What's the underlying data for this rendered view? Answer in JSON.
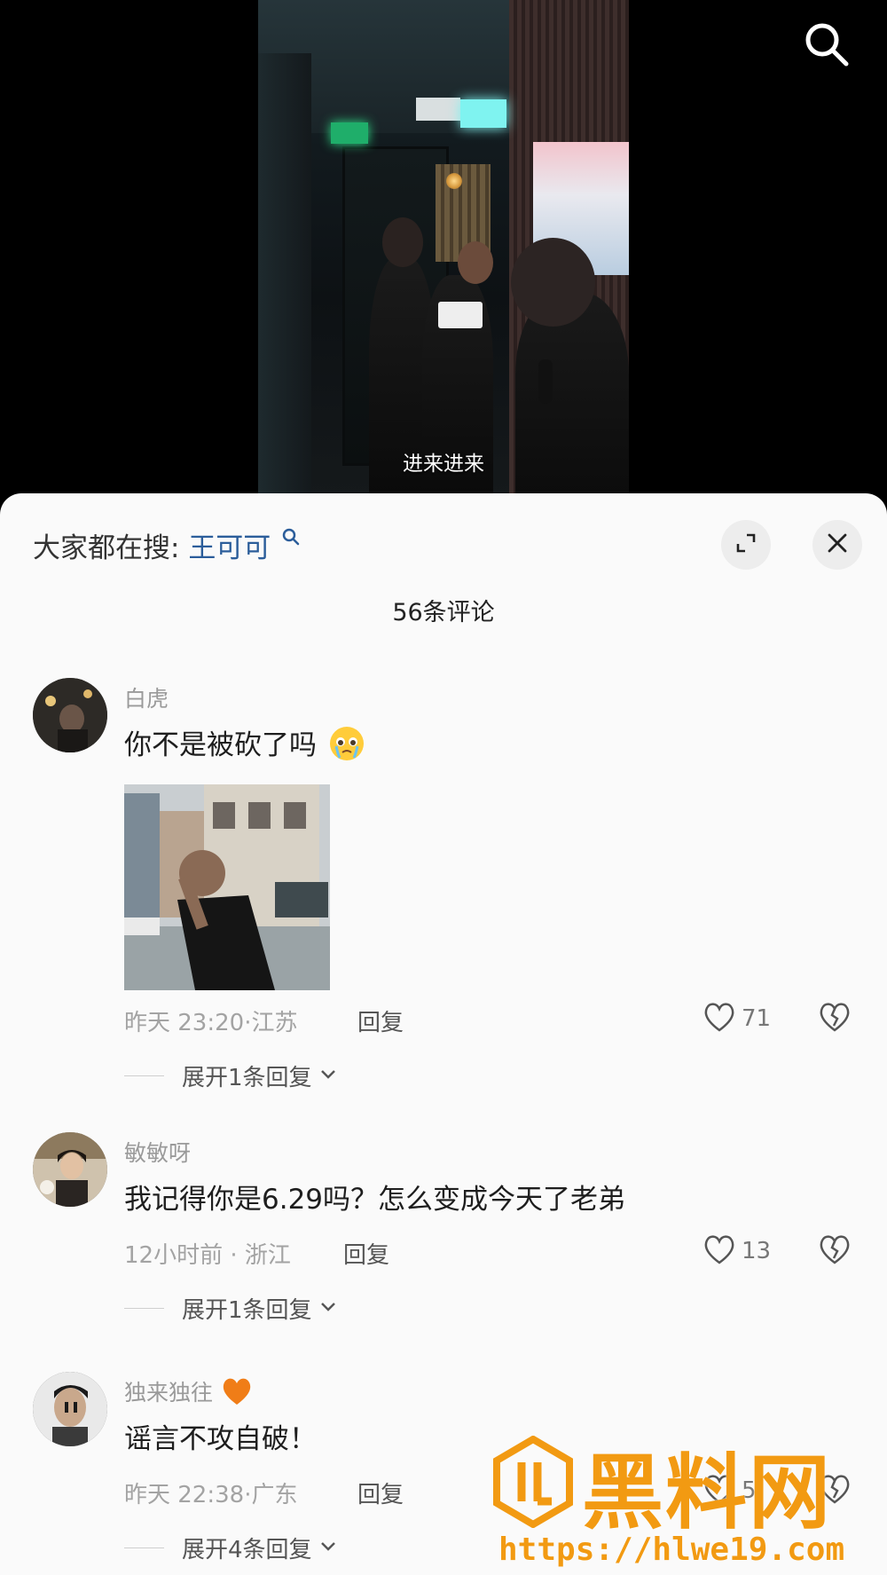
{
  "video": {
    "subtitle": "进来进来"
  },
  "header": {
    "hot_search_label": "大家都在搜:",
    "hot_search_term": "王可可",
    "comment_count": "56条评论"
  },
  "comments": [
    {
      "username": "白虎",
      "text": "你不是被砍了吗",
      "time": "昨天 23:20",
      "location": "江苏",
      "reply_label": "回复",
      "likes": "71",
      "expand_label": "展开1条回复"
    },
    {
      "username": "敏敏呀",
      "text": "我记得你是6.29吗？怎么变成今天了老弟",
      "time": "12小时前",
      "location": "浙江",
      "reply_label": "回复",
      "likes": "13",
      "expand_label": "展开1条回复"
    },
    {
      "username": "独来独往",
      "text": "谣言不攻自破！",
      "time": "昨天 22:38",
      "location": "广东",
      "reply_label": "回复",
      "likes": "5",
      "expand_label": "展开4条回复"
    }
  ],
  "watermark": {
    "name": "黑料网",
    "url": "https://hlwe19.com"
  },
  "colors": {
    "link_blue": "#2b5d9a",
    "watermark_orange": "#f29a12",
    "heart_orange": "#f07d17"
  },
  "icons": [
    "search-icon",
    "expand-icon",
    "close-icon",
    "heart-icon",
    "broken-heart-icon",
    "chevron-down-icon",
    "crying-emoji-icon",
    "orange-heart-icon"
  ]
}
